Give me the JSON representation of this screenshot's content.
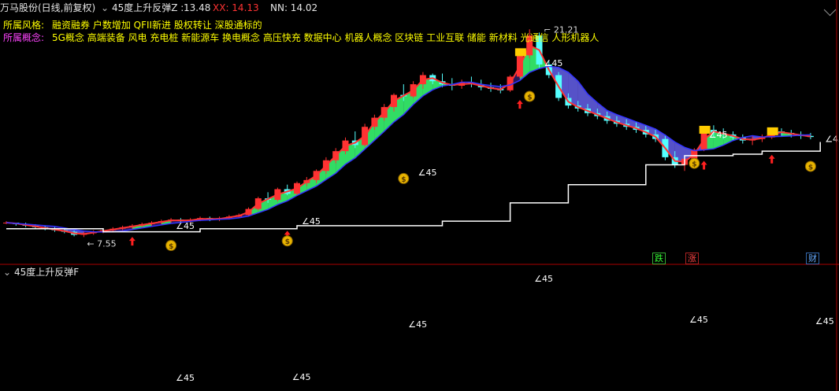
{
  "header": {
    "stock_title": "万马股份(日线,前复权)",
    "indicator_name": "45度上升反弹Z :",
    "z_value": "13.48",
    "xx_label": "XX: 14.13",
    "nn_label": "NN: 14.02"
  },
  "info": {
    "style_label": "所属风格:",
    "style_value": "融资融券 户数增加 QFII新进 股权转让 深股通标的",
    "concept_label": "所属概念:",
    "concept_value": "5G概念 高端装备 风电 充电桩 新能源车 换电概念 高压快充 数据中心 机器人概念 区块链 工业互联 储能 新材料 光通信 人形机器人"
  },
  "annotations": {
    "high_label": "21.21",
    "low_label": "7.55",
    "angle_label": "∠45",
    "money_icon": "money-bag-icon",
    "up_arrow_icon": "red-up-arrow-icon"
  },
  "markers": {
    "die": "跌",
    "zhang": "涨",
    "cai": "财"
  },
  "sub_panel": {
    "title": "45度上升反弹F"
  },
  "colors": {
    "up_candle": "#ff3232",
    "down_candle": "#54ffff",
    "line_red": "#ff3333",
    "line_blue": "#3333ff",
    "fill_green": "#33ff66",
    "fill_purple": "#2a1a5e",
    "fill_blue": "#6666ee",
    "support_line": "#ffffff",
    "gold": "#ffcc00",
    "divider": "#aa0000"
  },
  "chart_data": {
    "type": "candlestick",
    "price_range": [
      7.0,
      22.0
    ],
    "high_point": 21.21,
    "low_point": 7.55,
    "candles": [
      [
        8.5,
        8.6,
        8.4,
        8.5
      ],
      [
        8.5,
        8.5,
        8.3,
        8.4
      ],
      [
        8.4,
        8.5,
        8.2,
        8.3
      ],
      [
        8.3,
        8.4,
        8.1,
        8.2
      ],
      [
        8.2,
        8.3,
        8.0,
        8.1
      ],
      [
        8.1,
        8.2,
        7.9,
        8.0
      ],
      [
        8.0,
        8.1,
        7.8,
        7.9
      ],
      [
        7.9,
        8.0,
        7.6,
        7.7
      ],
      [
        7.7,
        7.9,
        7.55,
        7.8
      ],
      [
        7.8,
        8.0,
        7.7,
        7.9
      ],
      [
        7.9,
        8.1,
        7.8,
        8.0
      ],
      [
        8.0,
        8.2,
        7.9,
        8.1
      ],
      [
        8.1,
        8.3,
        8.0,
        8.2
      ],
      [
        8.2,
        8.4,
        8.1,
        8.3
      ],
      [
        8.3,
        8.5,
        8.2,
        8.4
      ],
      [
        8.4,
        8.6,
        8.3,
        8.5
      ],
      [
        8.5,
        8.7,
        8.4,
        8.6
      ],
      [
        8.6,
        8.8,
        8.5,
        8.7
      ],
      [
        8.7,
        8.8,
        8.5,
        8.6
      ],
      [
        8.6,
        8.8,
        8.5,
        8.7
      ],
      [
        8.7,
        8.9,
        8.6,
        8.8
      ],
      [
        8.8,
        8.9,
        8.6,
        8.7
      ],
      [
        8.7,
        8.9,
        8.6,
        8.8
      ],
      [
        8.8,
        9.0,
        8.7,
        8.9
      ],
      [
        8.9,
        9.1,
        8.8,
        9.0
      ],
      [
        9.0,
        9.5,
        8.9,
        9.4
      ],
      [
        9.4,
        10.2,
        9.3,
        10.1
      ],
      [
        10.1,
        10.5,
        9.8,
        10.0
      ],
      [
        10.0,
        10.8,
        9.9,
        10.7
      ],
      [
        10.7,
        11.0,
        10.3,
        10.4
      ],
      [
        10.4,
        11.2,
        10.3,
        11.1
      ],
      [
        11.1,
        11.5,
        10.9,
        11.3
      ],
      [
        11.3,
        12.0,
        11.1,
        11.9
      ],
      [
        11.9,
        12.8,
        11.7,
        12.6
      ],
      [
        12.6,
        13.4,
        12.4,
        13.2
      ],
      [
        13.2,
        14.1,
        13.0,
        13.9
      ],
      [
        13.9,
        14.5,
        13.4,
        13.6
      ],
      [
        13.6,
        15.0,
        13.5,
        14.8
      ],
      [
        14.8,
        15.6,
        14.6,
        15.4
      ],
      [
        15.4,
        16.3,
        15.2,
        16.1
      ],
      [
        16.1,
        17.0,
        15.8,
        16.9
      ],
      [
        16.9,
        17.6,
        16.5,
        16.8
      ],
      [
        16.8,
        17.8,
        16.7,
        17.6
      ],
      [
        17.6,
        18.4,
        17.3,
        18.2
      ],
      [
        18.2,
        18.3,
        17.6,
        17.8
      ],
      [
        17.8,
        18.3,
        17.4,
        17.6
      ],
      [
        17.6,
        18.0,
        17.2,
        17.5
      ],
      [
        17.5,
        17.9,
        17.3,
        17.7
      ],
      [
        17.7,
        18.1,
        17.4,
        17.6
      ],
      [
        17.6,
        17.9,
        17.2,
        17.4
      ],
      [
        17.4,
        17.7,
        17.1,
        17.3
      ],
      [
        17.3,
        17.6,
        17.0,
        17.2
      ],
      [
        17.2,
        18.2,
        17.1,
        18.1
      ],
      [
        18.1,
        19.7,
        18.0,
        19.5
      ],
      [
        19.5,
        21.21,
        19.3,
        20.8
      ],
      [
        20.8,
        21.0,
        18.6,
        18.9
      ],
      [
        18.9,
        19.1,
        18.0,
        18.2
      ],
      [
        18.2,
        18.4,
        16.5,
        16.7
      ],
      [
        16.7,
        17.0,
        16.0,
        16.2
      ],
      [
        16.2,
        16.5,
        15.8,
        16.0
      ],
      [
        16.0,
        16.3,
        15.5,
        15.7
      ],
      [
        15.7,
        16.0,
        15.3,
        15.5
      ],
      [
        15.5,
        15.8,
        15.0,
        15.2
      ],
      [
        15.2,
        15.5,
        14.8,
        15.0
      ],
      [
        15.0,
        15.3,
        14.6,
        14.8
      ],
      [
        14.8,
        15.1,
        14.4,
        14.6
      ],
      [
        14.6,
        14.9,
        14.1,
        14.3
      ],
      [
        14.3,
        14.6,
        13.8,
        14.0
      ],
      [
        14.0,
        14.3,
        12.6,
        12.8
      ],
      [
        12.8,
        13.2,
        12.1,
        12.3
      ],
      [
        12.3,
        12.9,
        11.9,
        12.7
      ],
      [
        12.7,
        13.4,
        12.6,
        13.3
      ],
      [
        13.3,
        14.8,
        13.2,
        14.6
      ],
      [
        14.6,
        14.9,
        14.1,
        14.4
      ],
      [
        14.4,
        14.7,
        14.0,
        14.3
      ],
      [
        14.3,
        14.5,
        13.9,
        14.1
      ],
      [
        14.1,
        14.3,
        13.7,
        13.9
      ],
      [
        13.9,
        14.2,
        13.6,
        14.0
      ],
      [
        14.0,
        14.3,
        13.8,
        14.1
      ],
      [
        14.1,
        14.6,
        14.0,
        14.5
      ],
      [
        14.5,
        14.7,
        14.2,
        14.4
      ],
      [
        14.4,
        14.6,
        14.1,
        14.3
      ],
      [
        14.3,
        14.5,
        14.0,
        14.2
      ],
      [
        14.2,
        14.4,
        13.98,
        14.13
      ]
    ],
    "support_line": [
      [
        0,
        8.1
      ],
      [
        10,
        7.9
      ],
      [
        20,
        8.1
      ],
      [
        30,
        8.3
      ],
      [
        40,
        8.3
      ],
      [
        45,
        8.6
      ],
      [
        52,
        9.8
      ],
      [
        58,
        11.0
      ],
      [
        66,
        12.3
      ],
      [
        70,
        12.9
      ],
      [
        75,
        13.0
      ],
      [
        78,
        13.2
      ],
      [
        84,
        13.8
      ]
    ],
    "legend": {
      "xx": 14.13,
      "nn": 14.02,
      "z": 13.48
    }
  }
}
